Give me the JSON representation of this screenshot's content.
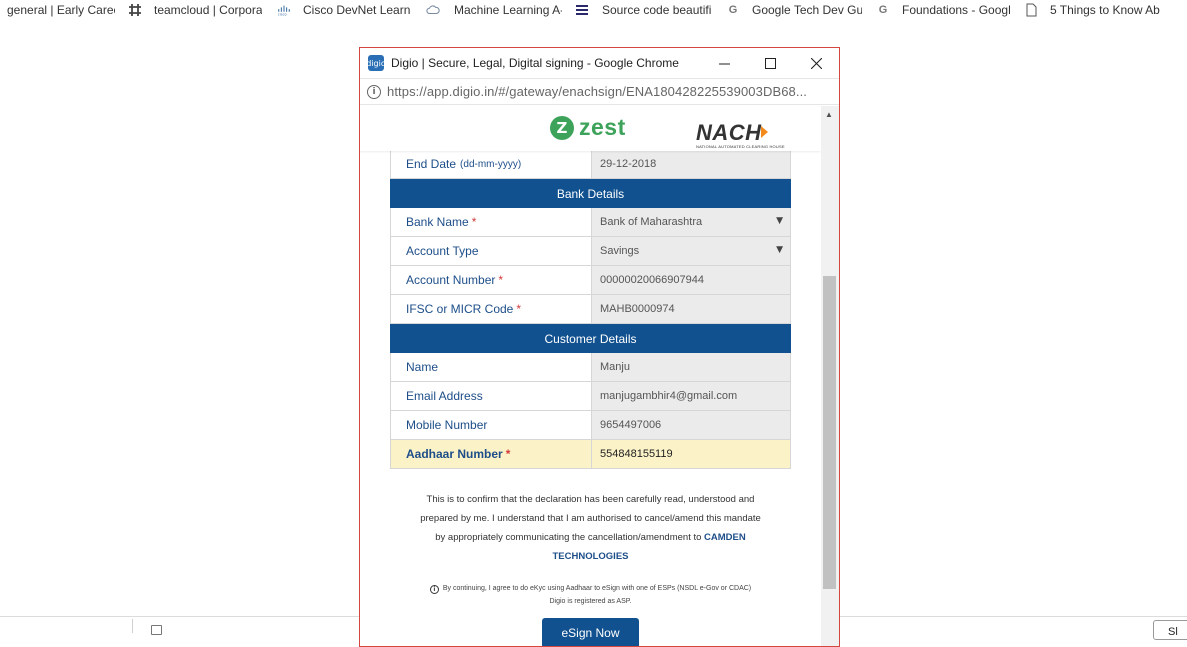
{
  "bookmarks": [
    {
      "label": "general | Early Caree",
      "icon": "none"
    },
    {
      "label": "teamcloud | Corpora",
      "icon": "slack-icon"
    },
    {
      "label": "Cisco DevNet Learnii",
      "icon": "cisco-icon"
    },
    {
      "label": "Machine Learning A-",
      "icon": "cloud-icon"
    },
    {
      "label": "Source code beautifi",
      "icon": "menu-icon"
    },
    {
      "label": "Google Tech Dev Gu",
      "icon": "google-icon"
    },
    {
      "label": "Foundations - Googl",
      "icon": "google-icon"
    },
    {
      "label": "5 Things to Know Ab",
      "icon": "document-icon"
    }
  ],
  "window": {
    "title": "Digio | Secure, Legal, Digital signing - Google Chrome",
    "app_icon_text": "digio",
    "url": "https://app.digio.in/#/gateway/enachsign/ENA180428225539003DB68..."
  },
  "logos": {
    "zest": "zest",
    "zest_mark": "Z",
    "nach": "NACH",
    "nach_sub": "NATIONAL AUTOMATED CLEARING HOUSE"
  },
  "form": {
    "end_date": {
      "label": "End  Date",
      "hint": "(dd-mm-yyyy)",
      "value": "29-12-2018"
    },
    "bank_section": "Bank Details",
    "bank_name": {
      "label": "Bank Name",
      "value": "Bank of Maharashtra"
    },
    "account_type": {
      "label": "Account Type",
      "value": "Savings"
    },
    "account_number": {
      "label": "Account Number",
      "value": "00000020066907944"
    },
    "ifsc": {
      "label": "IFSC or MICR Code",
      "value": "MAHB0000974"
    },
    "customer_section": "Customer Details",
    "name": {
      "label": "Name",
      "value": "Manju"
    },
    "email": {
      "label": "Email Address",
      "value": "manjugambhir4@gmail.com"
    },
    "mobile": {
      "label": "Mobile Number",
      "value": "9654497006"
    },
    "aadhaar": {
      "label": "Aadhaar Number",
      "value": "554848155119"
    },
    "required_mark": "*"
  },
  "declaration": {
    "line1": "This is to confirm that the declaration has been carefully read, understood and",
    "line2": "prepared by me. I understand that I am authorised to cancel/amend this mandate",
    "line3": "by appropriately communicating the cancellation/amendment to",
    "company_part1": "CAMDEN",
    "company_part2": "TECHNOLOGIES"
  },
  "consent": {
    "icon_text": "i",
    "line1": "By continuing, I agree to do eKyc using Aadhaar to eSign with one of ESPs (NSDL e-Gov or CDAC)",
    "line2": "Digio is registered as ASP."
  },
  "esign_button": "eSign Now",
  "corner_button": "Sl",
  "colors": {
    "header_blue": "#11518f",
    "label_blue": "#1d4e89",
    "required_red": "#d23b3b",
    "zest_green": "#3da35a",
    "highlight_yellow": "#fbf2c7",
    "popup_border": "#d4463e"
  }
}
